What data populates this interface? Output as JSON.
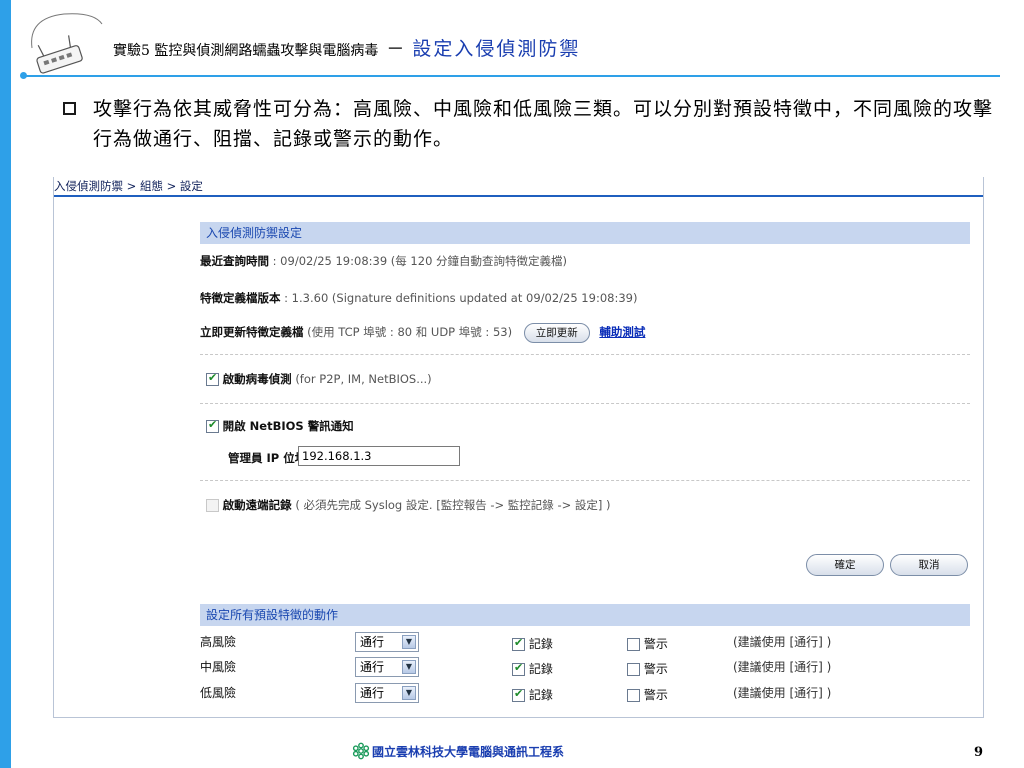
{
  "header": {
    "title": "實驗5 監控與偵測網路蠕蟲攻擊與電腦病毒",
    "separator": "－",
    "topic": "設定入侵偵測防禦"
  },
  "bullet": {
    "text": "攻擊行為依其威脅性可分為：高風險、中風險和低風險三類。可以分別對預設特徵中，不同風險的攻擊行為做通行、阻擋、記錄或警示的動作。"
  },
  "breadcrumb": "入侵偵測防禦 > 組態 > 設定",
  "ids_settings": {
    "section_title": "入侵偵測防禦設定",
    "last_query_label": "最近查詢時間",
    "last_query_value": ": 09/02/25 19:08:39 (每 120 分鐘自動查詢特徵定義檔)",
    "version_label": "特徵定義檔版本",
    "version_value": ": 1.3.60 (Signature definitions updated at 09/02/25 19:08:39)",
    "update_label": "立即更新特徵定義檔",
    "update_value": "(使用 TCP 埠號 : 80 和 UDP 埠號 : 53)",
    "update_button": "立即更新",
    "help_link": "輔助測試",
    "virus_label": "啟動病毒偵測",
    "virus_note": "(for P2P, IM, NetBIOS...)",
    "virus_checked": true,
    "netbios_label": "開啟 NetBIOS 警訊通知",
    "netbios_checked": true,
    "admin_ip_label": "管理員 IP 位址",
    "admin_ip_value": "192.168.1.3",
    "remote_log_label": "啟動遠端記錄",
    "remote_log_note": "( 必須先完成 Syslog 設定. [監控報告 -> 監控記錄 -> 設定] )",
    "remote_log_checked": false,
    "confirm_button": "確定",
    "cancel_button": "取消"
  },
  "actions": {
    "section_title": "設定所有預設特徵的動作",
    "rows": [
      {
        "risk": "高風險",
        "action": "通行",
        "log_label": "記錄",
        "log_checked": true,
        "alert_label": "警示",
        "alert_checked": false,
        "note": "(建議使用 [通行] )"
      },
      {
        "risk": "中風險",
        "action": "通行",
        "log_label": "記錄",
        "log_checked": true,
        "alert_label": "警示",
        "alert_checked": false,
        "note": "(建議使用 [通行] )"
      },
      {
        "risk": "低風險",
        "action": "通行",
        "log_label": "記錄",
        "log_checked": true,
        "alert_label": "警示",
        "alert_checked": false,
        "note": "(建議使用 [通行] )"
      }
    ]
  },
  "footer": {
    "school": "國立雲林科技大學電腦與通訊工程系",
    "page_number": "9"
  },
  "colors": {
    "accent": "#2ea0e8",
    "topic_blue": "#1a3eb0",
    "section_bar": "#c7d6ef",
    "breadcrumb_rule": "#1f5fbf"
  }
}
